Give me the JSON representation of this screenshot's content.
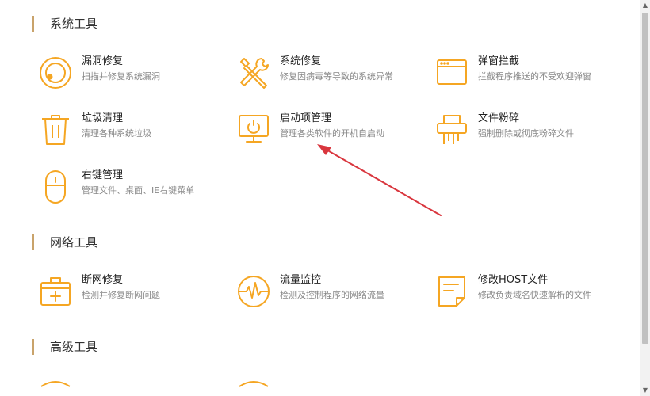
{
  "sections": [
    {
      "title": "系统工具",
      "tools": [
        {
          "name": "漏洞修复",
          "desc": "扫描并修复系统漏洞",
          "icon": "shield-target-icon"
        },
        {
          "name": "系统修复",
          "desc": "修复因病毒等导致的系统异常",
          "icon": "wrench-screwdriver-icon"
        },
        {
          "name": "弹窗拦截",
          "desc": "拦截程序推送的不受欢迎弹窗",
          "icon": "window-popup-icon"
        },
        {
          "name": "垃圾清理",
          "desc": "清理各种系统垃圾",
          "icon": "trash-can-icon"
        },
        {
          "name": "启动项管理",
          "desc": "管理各类软件的开机自启动",
          "icon": "monitor-power-icon"
        },
        {
          "name": "文件粉碎",
          "desc": "强制删除或彻底粉碎文件",
          "icon": "shredder-icon"
        },
        {
          "name": "右键管理",
          "desc": "管理文件、桌面、IE右键菜单",
          "icon": "mouse-icon"
        }
      ]
    },
    {
      "title": "网络工具",
      "tools": [
        {
          "name": "断网修复",
          "desc": "检测并修复断网问题",
          "icon": "first-aid-kit-icon"
        },
        {
          "name": "流量监控",
          "desc": "检测及控制程序的网络流量",
          "icon": "pulse-wave-icon"
        },
        {
          "name": "修改HOST文件",
          "desc": "修改负责域名快速解析的文件",
          "icon": "document-edit-icon"
        }
      ]
    },
    {
      "title": "高级工具",
      "tools": [
        {
          "name": "",
          "desc": "",
          "icon": "partial-icon"
        },
        {
          "name": "",
          "desc": "",
          "icon": "partial-icon"
        }
      ]
    }
  ],
  "colors": {
    "accent": "#f5a623",
    "section_bar": "#c9a36b",
    "annotation_arrow": "#d9363e"
  }
}
